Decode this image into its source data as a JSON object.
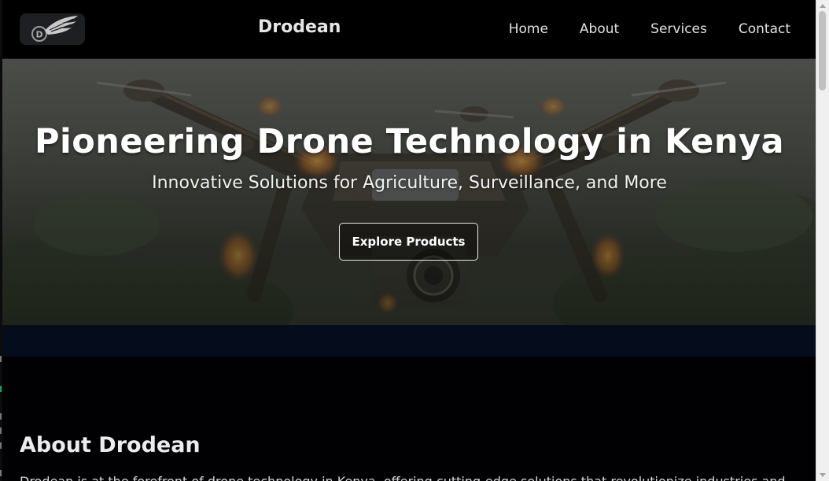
{
  "header": {
    "brand": "Drodean",
    "nav": [
      "Home",
      "About",
      "Services",
      "Contact"
    ]
  },
  "hero": {
    "title": "Pioneering Drone Technology in Kenya",
    "subtitle": "Innovative Solutions for Agriculture, Surveillance, and More",
    "button": "Explore Products"
  },
  "about": {
    "title": "About Drodean",
    "text": "Drodean is at the forefront of drone technology in Kenya, offering cutting-edge solutions that revolutionize industries and"
  },
  "icons": {
    "logo": "winged-d-logo-icon"
  },
  "colors": {
    "header_bg": "#000000",
    "band": "#050c1c",
    "page_bg": "#010104"
  }
}
